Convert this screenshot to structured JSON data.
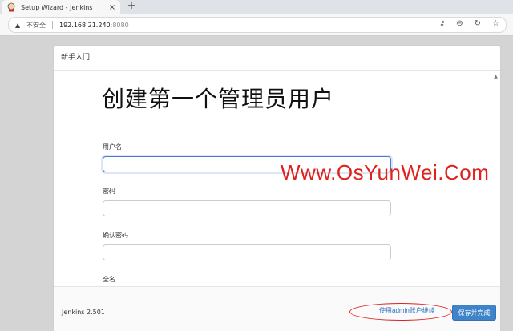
{
  "browser": {
    "tab_title": "Setup Wizard - Jenkins",
    "new_tab_icon": "+",
    "security_label": "不安全",
    "url_host": "192.168.21.240",
    "url_port": ":8080"
  },
  "dialog": {
    "header": "新手入门",
    "title": "创建第一个管理员用户",
    "fields": [
      {
        "label": "用户名",
        "value": ""
      },
      {
        "label": "密码",
        "value": ""
      },
      {
        "label": "确认密码",
        "value": ""
      },
      {
        "label": "全名",
        "value": ""
      }
    ],
    "version": "Jenkins 2.501",
    "skip_label": "使用admin账户继续",
    "save_label": "保存并完成"
  },
  "watermark": "Www.OsYunWei.Com",
  "colors": {
    "primary_button": "#3f84c9",
    "link": "#2e6fc2",
    "watermark": "#e0211c",
    "focus_border": "#4a7bd0"
  }
}
